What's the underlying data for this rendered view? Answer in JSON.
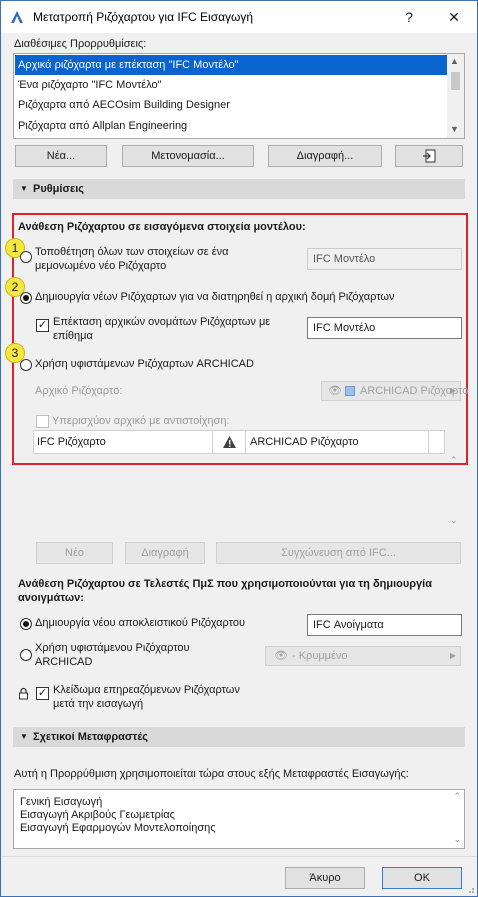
{
  "window": {
    "title": "Μετατροπή Ριζόχαρτου για IFC Εισαγωγή",
    "help_label": "?",
    "close_label": "✕"
  },
  "presets": {
    "label": "Διαθέσιμες Προρρυθμίσεις:",
    "items": [
      "Αρχικά ριζόχαρτα με επέκταση \"IFC Μοντέλο\"",
      "Ένα ριζόχαρτο \"IFC Μοντέλο\"",
      "Ριζόχαρτα από AECOsim Building Designer",
      "Ριζόχαρτα από Allplan Engineering"
    ],
    "selected_index": 0,
    "buttons": {
      "new": "Νέα...",
      "rename": "Μετονομασία...",
      "delete": "Διαγραφή...",
      "import_icon": "import-icon"
    }
  },
  "settings": {
    "header": "Ρυθμίσεις",
    "heading": "Ανάθεση Ριζόχαρτου σε εισαγόμενα στοιχεία μοντέλου:",
    "option1_line1": "Τοποθέτηση όλων των στοιχείων σε ένα",
    "option1_line2": "μεμονωμένο νέο Ριζόχαρτο",
    "option1_value": "IFC Μοντέλο",
    "option2": "Δημιουργία νέων Ριζόχαρτων για να διατηρηθεί η αρχική δομή Ριζόχαρτων",
    "extend_line1": "Επέκταση αρχικών ονομάτων Ριζόχαρτων με",
    "extend_line2": "επίθημα",
    "extend_value": "IFC Μοντέλο",
    "option3": "Χρήση υφιστάμενων Ριζόχαρτων ARCHICAD",
    "original_label": "Αρχικό Ριζόχαρτο:",
    "original_dropdown": "ARCHICAD Ριζόχαρτο",
    "existing_mapping": "Υπερισχύον αρχικό με αντιστοίχηση:",
    "grid_col1": "IFC Ριζόχαρτο",
    "grid_col3": "ARCHICAD Ριζόχαρτο",
    "badges": [
      "1",
      "2",
      "3"
    ],
    "buttons": {
      "new": "Νέο",
      "delete": "Διαγραφή",
      "merge": "Συγχώνευση από IFC..."
    }
  },
  "openings": {
    "heading_line1": "Ανάθεση Ριζόχαρτου σε Τελεστές ΠμΣ που χρησιμοποιούνται για τη δημιουργία",
    "heading_line2": "ανοιγμάτων:",
    "option1": "Δημιουργία νέου αποκλειστικού Ριζόχαρτου",
    "option1_value": "IFC Ανοίγματα",
    "option2_line1": "Χρήση υφιστάμενου Ριζόχαρτου",
    "option2_line2": "ARCHICAD",
    "option2_dropdown": "- Κρυμμένο",
    "lock_line1": "Κλείδωμα επηρεαζόμενων Ριζόχαρτων",
    "lock_line2": "μετά την εισαγωγή"
  },
  "translators": {
    "header": "Σχετικοί Μεταφραστές",
    "description": "Αυτή η Προρρύθμιση χρησιμοποιείται τώρα στους εξής Μεταφραστές Εισαγωγής:",
    "items": [
      "Γενική Εισαγωγή",
      "Εισαγωγή Ακριβούς Γεωμετρίας",
      "Εισαγωγή Εφαρμογών Μοντελοποίησης"
    ]
  },
  "footer": {
    "cancel": "Άκυρο",
    "ok": "OK"
  },
  "colors": {
    "selection": "#0a64d0",
    "highlight_box": "#d9232d",
    "badge": "#f5e642"
  }
}
